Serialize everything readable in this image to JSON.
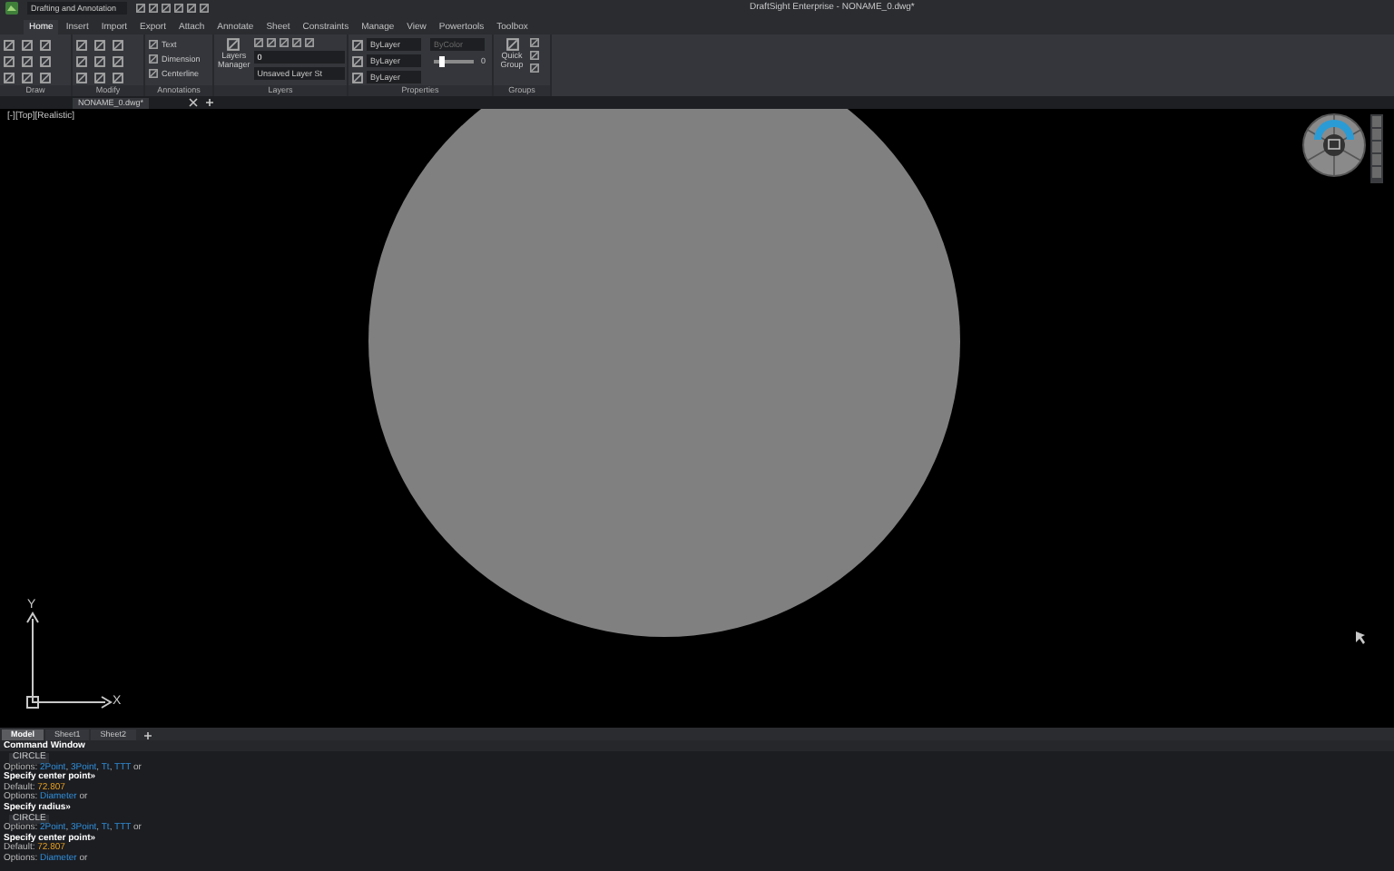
{
  "title_bar": {
    "workspace": "Drafting and Annotation",
    "title": "DraftSight Enterprise - NONAME_0.dwg*"
  },
  "ribbon_tabs": [
    {
      "label": "Home",
      "selected": true
    },
    {
      "label": "Insert",
      "selected": false
    },
    {
      "label": "Import",
      "selected": false
    },
    {
      "label": "Export",
      "selected": false
    },
    {
      "label": "Attach",
      "selected": false
    },
    {
      "label": "Annotate",
      "selected": false
    },
    {
      "label": "Sheet",
      "selected": false
    },
    {
      "label": "Constraints",
      "selected": false
    },
    {
      "label": "Manage",
      "selected": false
    },
    {
      "label": "View",
      "selected": false
    },
    {
      "label": "Powertools",
      "selected": false
    },
    {
      "label": "Toolbox",
      "selected": false
    }
  ],
  "ribbon": {
    "draw": {
      "title": "Draw"
    },
    "modify": {
      "title": "Modify"
    },
    "annotations": {
      "title": "Annotations",
      "tools": [
        "Text",
        "Dimension",
        "Centerline"
      ]
    },
    "layers": {
      "title": "Layers",
      "button": "Layers Manager",
      "layer": "0",
      "layer_state": "Unsaved Layer St"
    },
    "properties": {
      "title": "Properties",
      "layer_color": "ByLayer",
      "lineweight": "ByLayer",
      "linetype": "ByLayer",
      "style_placeholder": "ByColor",
      "transparency": {
        "level": 0.15,
        "reading": "0"
      }
    },
    "groups": {
      "title": "Groups",
      "button": "Quick Group"
    }
  },
  "document_tabs": [
    {
      "label": "NONAME_0.dwg*",
      "selected": true
    }
  ],
  "viewport": {
    "label": "[-][Top][Realistic]",
    "ucs": {
      "x": "X",
      "y": "Y"
    }
  },
  "layout_tabs": [
    {
      "label": "Model",
      "selected": true
    },
    {
      "label": "Sheet1",
      "selected": false
    },
    {
      "label": "Sheet2",
      "selected": false
    }
  ],
  "command_window": {
    "title": "Command Window",
    "lines": [
      {
        "kind": "command",
        "parts": [
          {
            "text": "CIRCLE",
            "kind": "plain"
          }
        ]
      },
      {
        "kind": "plain",
        "parts": [
          {
            "text": "Options: ",
            "kind": "plain"
          },
          {
            "text": "2Point",
            "kind": "link"
          },
          {
            "text": ", ",
            "kind": "plain"
          },
          {
            "text": "3Point",
            "kind": "link"
          },
          {
            "text": ", ",
            "kind": "plain"
          },
          {
            "text": "Tt",
            "kind": "link"
          },
          {
            "text": ", ",
            "kind": "plain"
          },
          {
            "text": "TTT",
            "kind": "link"
          },
          {
            "text": " or",
            "kind": "plain"
          }
        ]
      },
      {
        "kind": "prompt",
        "parts": [
          {
            "text": "Specify center point»",
            "kind": "plain"
          }
        ]
      },
      {
        "kind": "plain",
        "parts": [
          {
            "text": "Default: ",
            "kind": "plain"
          },
          {
            "text": "72.807",
            "kind": "value"
          }
        ]
      },
      {
        "kind": "plain",
        "parts": [
          {
            "text": "Options: ",
            "kind": "plain"
          },
          {
            "text": "Diameter",
            "kind": "link"
          },
          {
            "text": " or",
            "kind": "plain"
          }
        ]
      },
      {
        "kind": "prompt",
        "parts": [
          {
            "text": "Specify radius»",
            "kind": "plain"
          }
        ]
      },
      {
        "kind": "command",
        "parts": [
          {
            "text": "CIRCLE",
            "kind": "plain"
          }
        ]
      },
      {
        "kind": "plain",
        "parts": [
          {
            "text": "Options: ",
            "kind": "plain"
          },
          {
            "text": "2Point",
            "kind": "link"
          },
          {
            "text": ", ",
            "kind": "plain"
          },
          {
            "text": "3Point",
            "kind": "link"
          },
          {
            "text": ", ",
            "kind": "plain"
          },
          {
            "text": "Tt",
            "kind": "link"
          },
          {
            "text": ", ",
            "kind": "plain"
          },
          {
            "text": "TTT",
            "kind": "link"
          },
          {
            "text": " or",
            "kind": "plain"
          }
        ]
      },
      {
        "kind": "prompt",
        "parts": [
          {
            "text": "Specify center point»",
            "kind": "plain"
          }
        ]
      },
      {
        "kind": "plain",
        "parts": [
          {
            "text": "Default: ",
            "kind": "plain"
          },
          {
            "text": "72.807",
            "kind": "value"
          }
        ]
      },
      {
        "kind": "plain",
        "parts": [
          {
            "text": "Options: ",
            "kind": "plain"
          },
          {
            "text": "Diameter",
            "kind": "link"
          },
          {
            "text": " or",
            "kind": "plain"
          }
        ]
      }
    ]
  }
}
